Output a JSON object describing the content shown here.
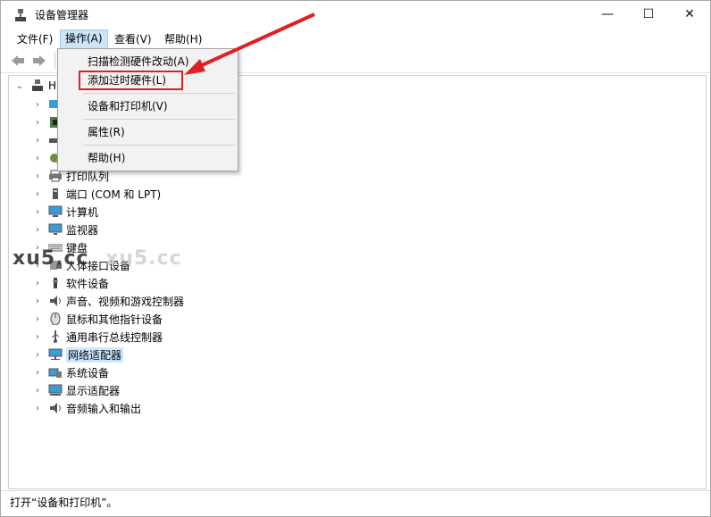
{
  "window": {
    "title": "设备管理器",
    "controls": {
      "minimize": "—",
      "maximize": "☐",
      "close": "✕"
    }
  },
  "menubar": {
    "file": "文件(F)",
    "action": "操作(A)",
    "view": "查看(V)",
    "help": "帮助(H)"
  },
  "action_menu": {
    "items": [
      {
        "label": "扫描检测硬件改动(A)"
      },
      {
        "label": "添加过时硬件(L)"
      },
      {
        "label": "设备和打印机(V)"
      },
      {
        "label": "属性(R)"
      },
      {
        "label": "帮助(H)"
      }
    ]
  },
  "tree": {
    "root_label": "H",
    "items": [
      {
        "label": "打印队列",
        "icon": "printer-icon"
      },
      {
        "label": "端口 (COM 和 LPT)",
        "icon": "port-icon"
      },
      {
        "label": "计算机",
        "icon": "computer-icon"
      },
      {
        "label": "监视器",
        "icon": "monitor-icon"
      },
      {
        "label": "键盘",
        "icon": "keyboard-icon"
      },
      {
        "label": "人体接口设备",
        "icon": "hid-icon"
      },
      {
        "label": "软件设备",
        "icon": "software-device-icon"
      },
      {
        "label": "声音、视频和游戏控制器",
        "icon": "speaker-icon"
      },
      {
        "label": "鼠标和其他指针设备",
        "icon": "mouse-icon"
      },
      {
        "label": "通用串行总线控制器",
        "icon": "usb-icon"
      },
      {
        "label": "网络适配器",
        "icon": "network-icon"
      },
      {
        "label": "系统设备",
        "icon": "system-device-icon"
      },
      {
        "label": "显示适配器",
        "icon": "display-adapter-icon"
      },
      {
        "label": "音频输入和输出",
        "icon": "audio-io-icon"
      }
    ]
  },
  "statusbar": {
    "text": "打开“设备和打印机”。"
  },
  "watermark": {
    "text_dark": "xu5.cc",
    "text_light": "xu5.cc"
  },
  "colors": {
    "highlight": "#e02020",
    "selection": "#cce8ff",
    "menu_active": "#cce4f7"
  }
}
